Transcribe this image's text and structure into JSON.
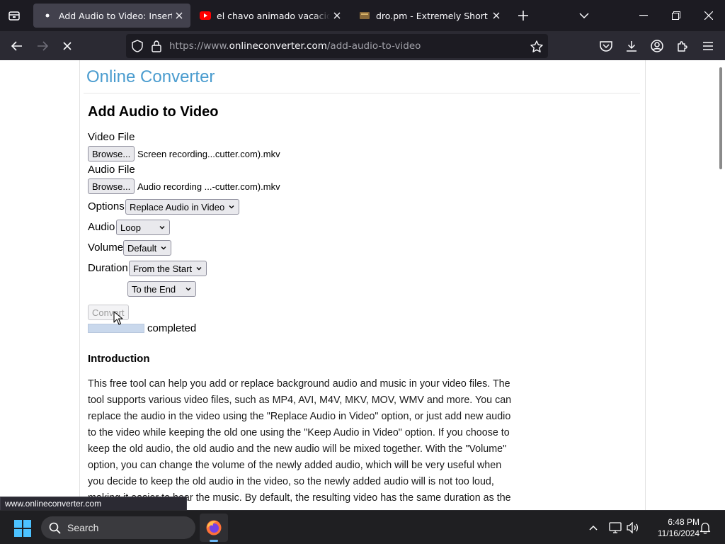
{
  "browser": {
    "tabs": [
      {
        "title": "Add Audio to Video: Insert Or Replace",
        "active": true,
        "favicon": "loading-dot-icon"
      },
      {
        "title": "el chavo animado vacaciones en",
        "active": false,
        "favicon": "youtube-icon"
      },
      {
        "title": "dro.pm - Extremely Short Links",
        "active": false,
        "favicon": "dropm-icon"
      }
    ],
    "url_prefix": "https://www.",
    "url_host": "onlineconverter.com",
    "url_path": "/add-audio-to-video"
  },
  "page": {
    "site_title": "Online Converter",
    "title": "Add Audio to Video",
    "form": {
      "video_label": "Video File",
      "video_browse": "Browse...",
      "video_filename": "Screen recording...cutter.com).mkv",
      "audio_label": "Audio File",
      "audio_browse": "Browse...",
      "audio_filename": "Audio recording ...-cutter.com).mkv",
      "options_label": "Options",
      "options_value": "Replace Audio in Video",
      "audio_mode_label": "Audio",
      "audio_mode_value": "Loop",
      "volume_label": "Volume",
      "volume_value": "Default",
      "duration_label": "Duration",
      "duration_start_value": "From the Start",
      "duration_end_value": "To the End",
      "convert_label": "Convert",
      "progress_fraction": 1.0,
      "progress_text": "completed"
    },
    "intro_heading": "Introduction",
    "intro_text": "This free tool can help you add or replace background audio and music in your video files. The tool supports various video files, such as MP4, AVI, M4V, MKV, MOV, WMV and more. You can replace the audio in the video using the \"Replace Audio in Video\" option, or just add new audio to the video while keeping the old one using the \"Keep Audio in Video\" option. If you choose to keep the old audio, the old audio and the new audio will be mixed together. With the \"Volume\" option, you can change the volume of the newly added audio, which will be very useful when you decide to keep the old audio in the video, so the newly added audio will is not too loud, making it easier to hear the music. By default, the resulting video has the same duration as the original"
  },
  "status_url": "www.onlineconverter.com",
  "taskbar": {
    "search_placeholder": "Search",
    "time": "6:48 PM",
    "date": "11/16/2024"
  }
}
